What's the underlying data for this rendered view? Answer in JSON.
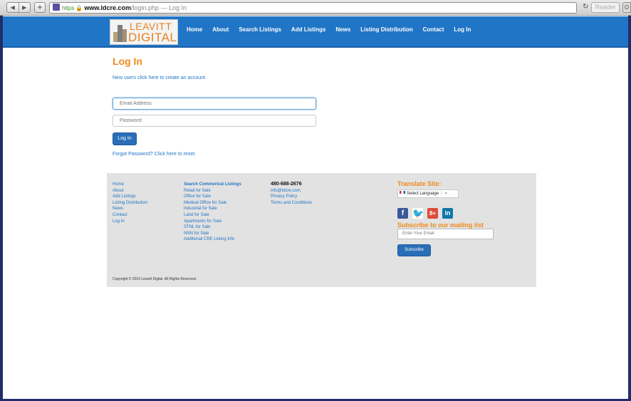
{
  "browser": {
    "back_glyph": "◀",
    "forward_glyph": "▶",
    "new_tab_glyph": "+",
    "url_https": "https",
    "url_lock": "🔒",
    "url_domain": "www.ldcre.com",
    "url_path": "/login.php — Log In",
    "reload_glyph": "↻",
    "reader_label": "Reader",
    "extra_glyph": "O"
  },
  "site": {
    "logo_line1": "LEAVITT",
    "logo_line2": "DIGITAL",
    "nav": [
      "Home",
      "About",
      "Search Listings",
      "Add Listings",
      "News",
      "Listing Distribution",
      "Contact",
      "Log In"
    ]
  },
  "login": {
    "title": "Log In",
    "new_users": "New users click here to create an account.",
    "email_placeholder": "Email Address",
    "password_placeholder": "Password",
    "button": "Log In",
    "forgot": "Forgot Password? Click here to reset."
  },
  "footer": {
    "col1": [
      "Home",
      "About",
      "Add Listings",
      "Listing Distribution",
      "News",
      "Contact",
      "Log In"
    ],
    "col2_head": "Search Commerical Listings",
    "col2": [
      "Retail for Sale",
      "Office for Sale",
      "Medical Office for Sale",
      "Industrial for Sale",
      "Land for Sale",
      "Apartments for Sale",
      "STNL for Sale",
      "NNN for Sale",
      "Additional CRE Listing Info"
    ],
    "phone": "480-688-2676",
    "col3": [
      "info@ldcre.com",
      "Privacy Policy",
      "Terms and Conditions"
    ],
    "translate_title": "Translate Site:",
    "select_language": "Select Language",
    "select_sep": "|",
    "select_arrow": "▼",
    "social": {
      "facebook": "f",
      "twitter": "🐦",
      "google": "8+",
      "linkedin": "in"
    },
    "subscribe_title": "Subscribe to our mailing list",
    "email_placeholder": "Enter Your Email",
    "subscribe_button": "Subscribe",
    "copyright": "Copyright © 2016 Leavitt Digital. All Rights Reserved."
  }
}
